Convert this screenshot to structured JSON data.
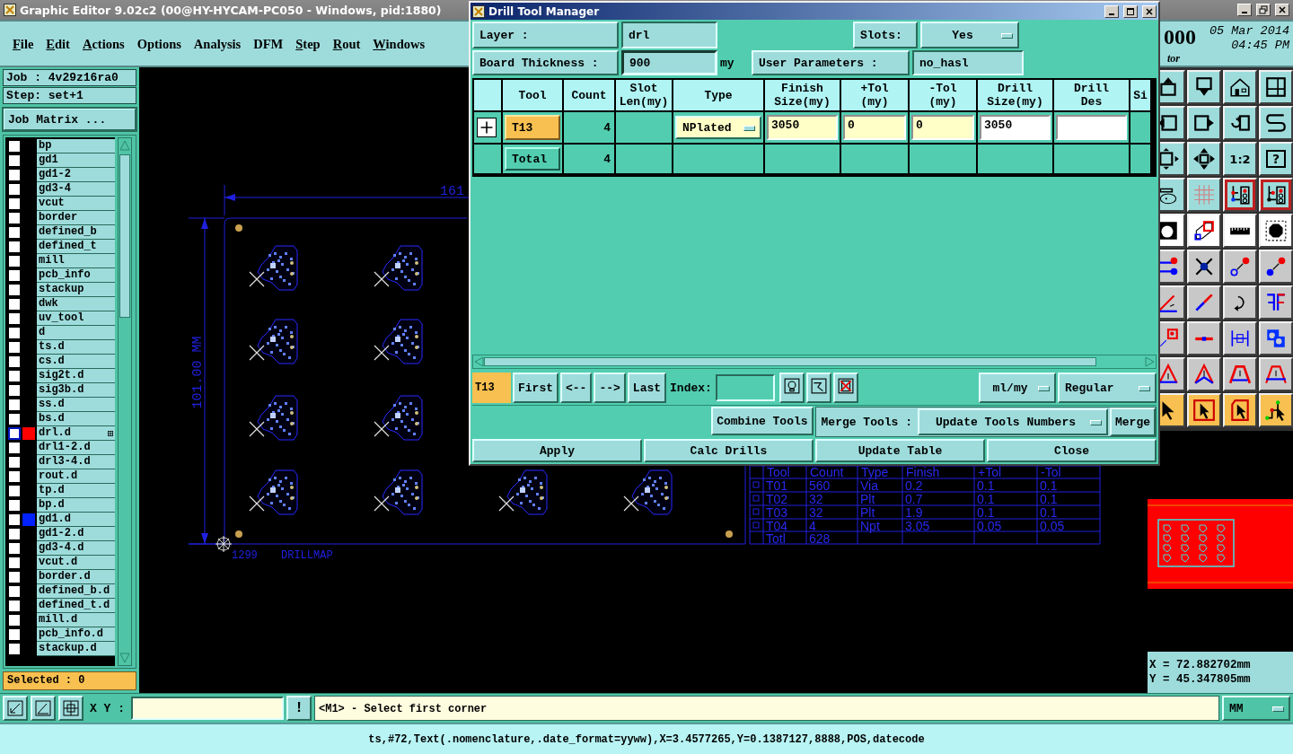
{
  "window": {
    "title": "Graphic Editor 9.02c2 (00@HY-HYCAM-PC050 - Windows, pid:1880)"
  },
  "menu": [
    {
      "label": "File",
      "underlined": true
    },
    {
      "label": "Edit",
      "underlined": true
    },
    {
      "label": "Actions",
      "underlined": true
    },
    {
      "label": "Options",
      "underlined": false
    },
    {
      "label": "Analysis",
      "underlined": false
    },
    {
      "label": "DFM",
      "underlined": false
    },
    {
      "label": "Step",
      "underlined": true
    },
    {
      "label": "Rout",
      "underlined": true
    },
    {
      "label": "Windows",
      "underlined": true
    }
  ],
  "clock": {
    "partial": "000",
    "date": "05 Mar 2014",
    "time": "04:45 PM",
    "caption": "tor"
  },
  "job_panel": {
    "job": "Job : 4v29z16ra0",
    "step": "Step: set+1",
    "matrix_button": "Job Matrix ...",
    "selected": "Selected : 0",
    "layers": [
      {
        "name": "bp",
        "active": false,
        "checked": false
      },
      {
        "name": "gd1",
        "active": false,
        "checked": false
      },
      {
        "name": "gd1-2",
        "active": false,
        "checked": false
      },
      {
        "name": "gd3-4",
        "active": false,
        "checked": false
      },
      {
        "name": "vcut",
        "active": false,
        "checked": false
      },
      {
        "name": "border",
        "active": false,
        "checked": false
      },
      {
        "name": "defined_b",
        "active": false,
        "checked": false
      },
      {
        "name": "defined_t",
        "active": false,
        "checked": false
      },
      {
        "name": "mill",
        "active": false,
        "checked": false
      },
      {
        "name": "pcb_info",
        "active": false,
        "checked": false
      },
      {
        "name": "stackup",
        "active": false,
        "checked": false
      },
      {
        "name": "dwk",
        "active": false,
        "checked": false
      },
      {
        "name": "uv_tool",
        "active": false,
        "checked": false
      },
      {
        "name": "d",
        "active": false,
        "checked": false
      },
      {
        "name": "ts.d",
        "active": false,
        "checked": false
      },
      {
        "name": "cs.d",
        "active": false,
        "checked": false
      },
      {
        "name": "sig2t.d",
        "active": false,
        "checked": false
      },
      {
        "name": "sig3b.d",
        "active": false,
        "checked": false
      },
      {
        "name": "ss.d",
        "active": false,
        "checked": false
      },
      {
        "name": "bs.d",
        "active": false,
        "checked": false
      },
      {
        "name": "drl.d",
        "active": true,
        "checked": false,
        "color": "#ff0000"
      },
      {
        "name": "drl1-2.d",
        "active": false,
        "checked": false
      },
      {
        "name": "drl3-4.d",
        "active": false,
        "checked": false
      },
      {
        "name": "rout.d",
        "active": false,
        "checked": false
      },
      {
        "name": "tp.d",
        "active": false,
        "checked": false
      },
      {
        "name": "bp.d",
        "active": false,
        "checked": false
      },
      {
        "name": "gd1.d",
        "active": false,
        "checked": false,
        "color": "#0022ff"
      },
      {
        "name": "gd1-2.d",
        "active": false,
        "checked": false
      },
      {
        "name": "gd3-4.d",
        "active": false,
        "checked": false
      },
      {
        "name": "vcut.d",
        "active": false,
        "checked": false
      },
      {
        "name": "border.d",
        "active": false,
        "checked": false
      },
      {
        "name": "defined_b.d",
        "active": false,
        "checked": false
      },
      {
        "name": "defined_t.d",
        "active": false,
        "checked": false
      },
      {
        "name": "mill.d",
        "active": false,
        "checked": false
      },
      {
        "name": "pcb_info.d",
        "active": false,
        "checked": false
      },
      {
        "name": "stackup.d",
        "active": false,
        "checked": false
      }
    ]
  },
  "canvas": {
    "width_label": "161",
    "height_label": "101.00 MM",
    "origin_label": "1299",
    "map_label": "DRILLMAP",
    "drill_table": {
      "columns": [
        "Tool",
        "Count",
        "Type",
        "Finish",
        "+Tol",
        "-Tol"
      ],
      "rows": [
        [
          "T01",
          "560",
          "Via",
          "0.2",
          "0.1",
          "0.1"
        ],
        [
          "T02",
          "32",
          "Plt",
          "0.7",
          "0.1",
          "0.1"
        ],
        [
          "T03",
          "32",
          "Plt",
          "1.9",
          "0.1",
          "0.1"
        ],
        [
          "T04",
          "4",
          "Npt",
          "3.05",
          "0.05",
          "0.05"
        ]
      ],
      "total": [
        "Totl",
        "628"
      ]
    }
  },
  "toolbar_labels": [
    "1:2",
    "?"
  ],
  "coords": {
    "x": "X = 72.882702mm",
    "y": "Y = 45.347805mm"
  },
  "command_bar": {
    "xy_label": "X Y :",
    "alert_button": "!",
    "message": "<M1> - Select first corner",
    "units": "MM"
  },
  "status_bar": "ts,#72,Text(.nomenclature,.date_format=yyww),X=3.4577265,Y=0.1387127,8888,POS,datecode",
  "dialog": {
    "title": "Drill Tool Manager",
    "layer_label": "Layer :",
    "layer": "drl",
    "slots_label": "Slots:",
    "slots": "Yes",
    "thickness_label": "Board Thickness :",
    "thickness": "900",
    "thickness_unit": "my",
    "user_params_label": "User Parameters :",
    "user_params": "no_hasl",
    "table": {
      "columns": [
        "Tool",
        "Count",
        "Slot\nLen(my)",
        "Type",
        "Finish\nSize(my)",
        "+Tol\n(my)",
        "-Tol\n(my)",
        "Drill\nSize(my)",
        "Drill\nDes",
        "Si"
      ],
      "rows": [
        {
          "tool": "T13",
          "count": "4",
          "type": "NPlated",
          "finish": "3050",
          "plus_tol": "0",
          "minus_tol": "0",
          "drill_size": "3050",
          "expanded": false
        }
      ],
      "total": {
        "label": "Total",
        "count": "4"
      }
    },
    "current_tool": "T13",
    "nav_buttons": [
      "First",
      "<--",
      "-->",
      "Last"
    ],
    "index_label": "Index:",
    "units": "ml/my",
    "mode": "Regular",
    "combine_button": "Combine Tools",
    "merge_label": "Merge Tools :",
    "merge_mode": "Update Tools Numbers",
    "merge_button": "Merge",
    "actions": [
      "Apply",
      "Calc Drills",
      "Update Table",
      "Close"
    ]
  }
}
